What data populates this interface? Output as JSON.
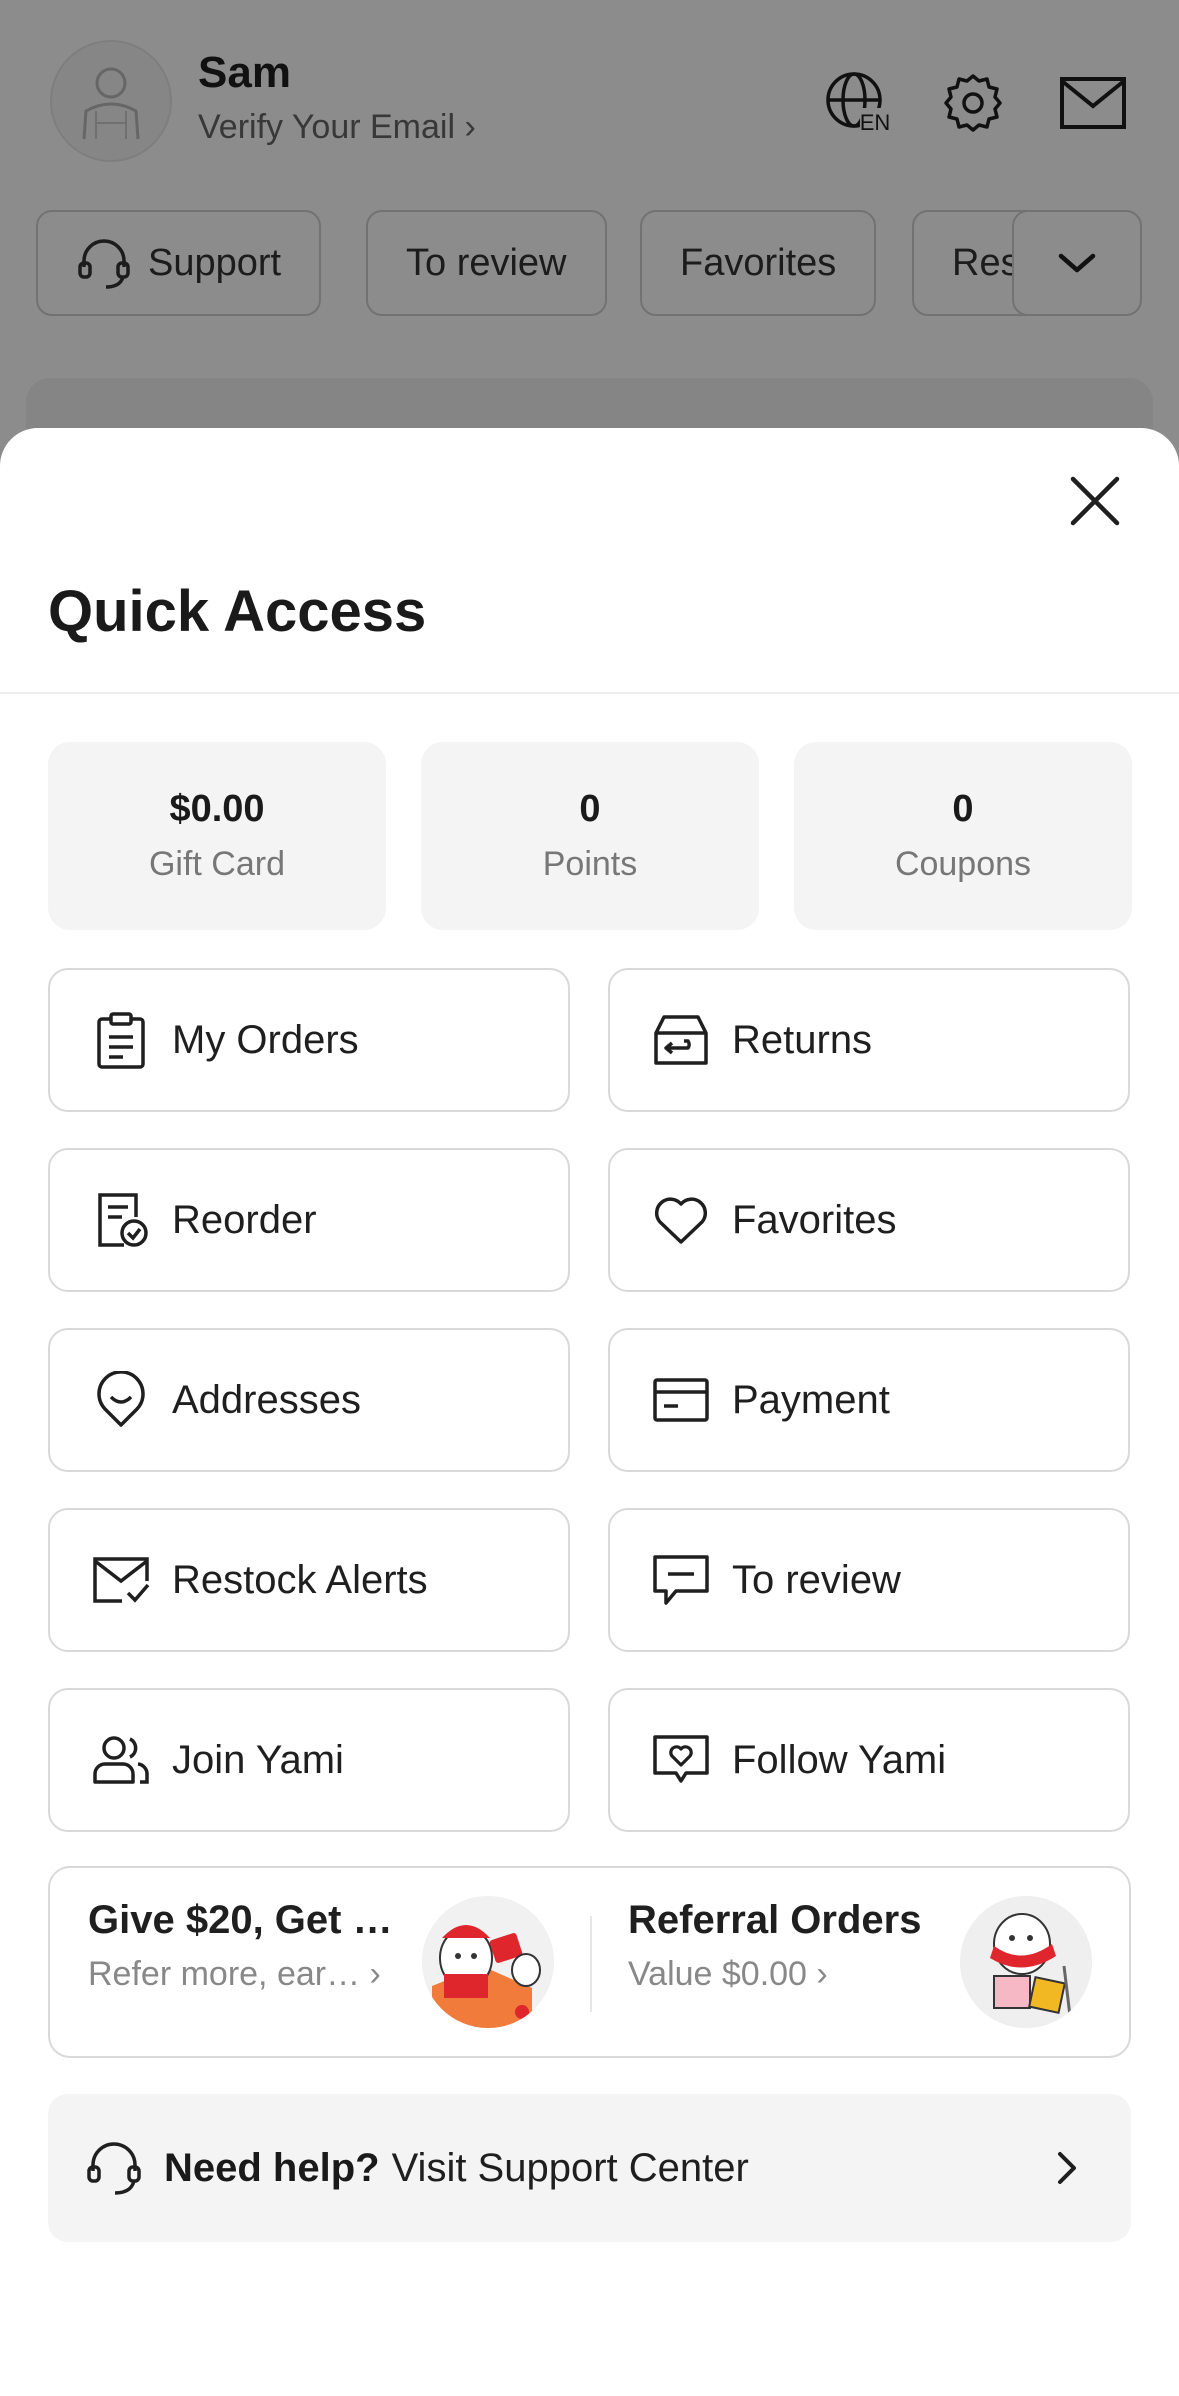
{
  "background": {
    "user": {
      "name": "Sam",
      "verify_label": "Verify Your Email ›"
    },
    "language_badge": "EN",
    "chips": [
      "Support",
      "To review",
      "Favorites",
      "Res"
    ]
  },
  "sheet": {
    "title": "Quick Access",
    "stats": [
      {
        "value": "$0.00",
        "label": "Gift Card"
      },
      {
        "value": "0",
        "label": "Points"
      },
      {
        "value": "0",
        "label": "Coupons"
      }
    ],
    "tiles": [
      {
        "label": "My Orders",
        "icon": "clipboard-icon"
      },
      {
        "label": "Returns",
        "icon": "return-box-icon"
      },
      {
        "label": "Reorder",
        "icon": "reorder-check-icon"
      },
      {
        "label": "Favorites",
        "icon": "heart-icon"
      },
      {
        "label": "Addresses",
        "icon": "location-pin-icon"
      },
      {
        "label": "Payment",
        "icon": "card-icon"
      },
      {
        "label": "Restock Alerts",
        "icon": "mail-check-icon"
      },
      {
        "label": "To review",
        "icon": "review-message-icon"
      },
      {
        "label": "Join Yami",
        "icon": "users-icon"
      },
      {
        "label": "Follow Yami",
        "icon": "heart-frame-icon"
      }
    ],
    "referral": {
      "left_title": "Give $20, Get …",
      "left_sub": "Refer more, ear… ›",
      "right_title": "Referral Orders",
      "right_sub": "Value $0.00 ›"
    },
    "help": {
      "strong": "Need help?",
      "text": "Visit Support Center"
    }
  },
  "colors": {
    "overlay": "#000000",
    "accent_red": "#e0262d",
    "tile_border": "#d9d9d9",
    "stat_bg": "#f4f4f4"
  }
}
